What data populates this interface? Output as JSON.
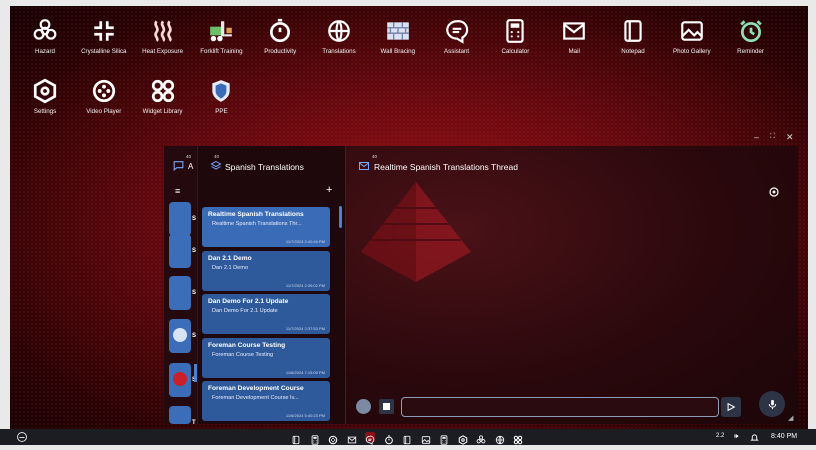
{
  "desktop": {
    "icons_row1": [
      {
        "label": "Hazard",
        "icon": "biohazard-icon"
      },
      {
        "label": "Crystalline Silica",
        "icon": "compress-arrows-icon"
      },
      {
        "label": "Heat Exposure",
        "icon": "heat-waves-icon"
      },
      {
        "label": "Forklift Training",
        "icon": "forklift-icon"
      },
      {
        "label": "Productivity",
        "icon": "stopwatch-icon"
      },
      {
        "label": "Translations",
        "icon": "globe-icon"
      },
      {
        "label": "Wall Bracing",
        "icon": "brick-wall-icon"
      },
      {
        "label": "Assistant",
        "icon": "chat-bubble-icon"
      },
      {
        "label": "Calculator",
        "icon": "calculator-icon"
      },
      {
        "label": "Mail",
        "icon": "mail-icon"
      },
      {
        "label": "Notepad",
        "icon": "notepad-icon"
      },
      {
        "label": "Photo Gallery",
        "icon": "photo-gallery-icon"
      },
      {
        "label": "Reminder",
        "icon": "alarm-clock-icon"
      }
    ],
    "icons_row2": [
      {
        "label": "Settings",
        "icon": "hexagon-settings-icon"
      },
      {
        "label": "Video Player",
        "icon": "film-reel-icon"
      },
      {
        "label": "Widget Library",
        "icon": "widgets-icon"
      },
      {
        "label": "PPE",
        "icon": "shield-icon"
      }
    ]
  },
  "window": {
    "rail_title": "A",
    "rail_badge": "40",
    "list_title": "Spanish Translations",
    "list_badge": "40",
    "thread_title": "Realtime Spanish Translations Thread",
    "thread_badge": "40",
    "add_label": "+",
    "rail_letters": [
      "S",
      "S",
      "S",
      "S",
      "S",
      "T"
    ],
    "conversations": [
      {
        "title": "Realtime Spanish Translations",
        "subtitle": "Realtime Spanish Translations Thr...",
        "date": "11/7/2024 2:40:46 PM"
      },
      {
        "title": "Dan 2.1 Demo",
        "subtitle": "Dan 2.1 Demo",
        "date": "11/7/2024 2:39:02 PM"
      },
      {
        "title": "Dan Demo For 2.1 Update",
        "subtitle": "Dan Demo For 2.1 Update",
        "date": "11/7/2024 2:37:53 PM"
      },
      {
        "title": "Foreman Course Testing",
        "subtitle": "Foreman Course Testing",
        "date": "11/6/2024 7:15:05 PM"
      },
      {
        "title": "Foreman Development Course",
        "subtitle": "Foreman Development Course Iv...",
        "date": "11/6/2024 5:40:23 PM"
      }
    ],
    "input_placeholder": ""
  },
  "taskbar": {
    "tray_text": "2.2",
    "clock": "8:40 PM"
  },
  "colors": {
    "accent_blue": "#3a6bb6",
    "background_red": "#8b0d14",
    "taskbar": "#1c1d22"
  }
}
